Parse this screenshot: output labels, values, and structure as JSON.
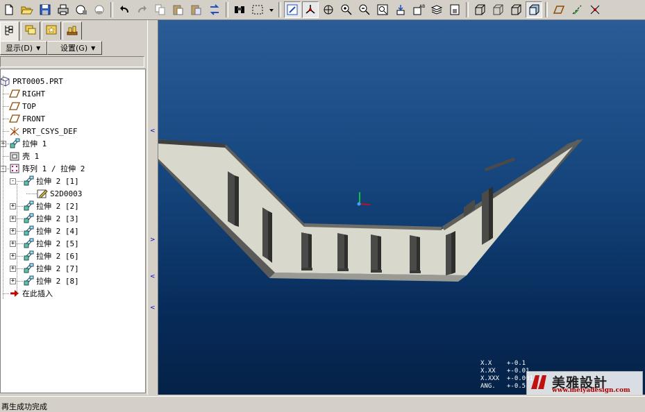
{
  "toolbar": {
    "icons": [
      "new-icon",
      "open-icon",
      "save-icon",
      "print-icon",
      "email-icon",
      "email-attach-icon",
      "undo-icon",
      "redo-icon",
      "copy-icon",
      "paste-icon",
      "paste-special-icon",
      "regenerate-icon",
      "find-icon",
      "select-box-icon",
      "dropdown-arrow-icon",
      "refit-icon",
      "spin-center-icon",
      "orient-icon",
      "zoom-in-icon",
      "zoom-out-icon",
      "zoom-fit-icon",
      "repaint-icon",
      "named-view-icon",
      "layers-icon",
      "view-manager-icon",
      "wireframe-icon",
      "hidden-line-icon",
      "no-hidden-icon",
      "shading-icon",
      "datum-plane-icon",
      "datum-axis-icon",
      "datum-point-icon"
    ]
  },
  "left_panel": {
    "tabs": [
      "model-tree-icon",
      "folder-browser-icon",
      "favorites-icon",
      "connections-icon"
    ],
    "show_menu": "显示(D)",
    "settings_menu": "设置(G)",
    "tree": [
      {
        "label": "PRT0005.PRT",
        "icon": "part-icon",
        "level": 0,
        "expander": ""
      },
      {
        "label": "RIGHT",
        "icon": "datum-plane-icon",
        "level": 1,
        "expander": ""
      },
      {
        "label": "TOP",
        "icon": "datum-plane-icon",
        "level": 1,
        "expander": ""
      },
      {
        "label": "FRONT",
        "icon": "datum-plane-icon",
        "level": 1,
        "expander": ""
      },
      {
        "label": "PRT_CSYS_DEF",
        "icon": "csys-icon",
        "level": 1,
        "expander": ""
      },
      {
        "label": "拉伸 1",
        "icon": "extrude-icon",
        "level": 1,
        "expander": "+"
      },
      {
        "label": "壳 1",
        "icon": "shell-icon",
        "level": 1,
        "expander": ""
      },
      {
        "label": "阵列 1 / 拉伸 2",
        "icon": "pattern-icon",
        "level": 1,
        "expander": "-"
      },
      {
        "label": "拉伸 2 [1]",
        "icon": "extrude-icon",
        "level": 2,
        "expander": "-"
      },
      {
        "label": "S2D0003",
        "icon": "sketch-icon",
        "level": 3,
        "expander": ""
      },
      {
        "label": "拉伸 2 [2]",
        "icon": "extrude-icon",
        "level": 2,
        "expander": "+"
      },
      {
        "label": "拉伸 2 [3]",
        "icon": "extrude-icon",
        "level": 2,
        "expander": "+"
      },
      {
        "label": "拉伸 2 [4]",
        "icon": "extrude-icon",
        "level": 2,
        "expander": "+"
      },
      {
        "label": "拉伸 2 [5]",
        "icon": "extrude-icon",
        "level": 2,
        "expander": "+"
      },
      {
        "label": "拉伸 2 [6]",
        "icon": "extrude-icon",
        "level": 2,
        "expander": "+"
      },
      {
        "label": "拉伸 2 [7]",
        "icon": "extrude-icon",
        "level": 2,
        "expander": "+"
      },
      {
        "label": "拉伸 2 [8]",
        "icon": "extrude-icon",
        "level": 2,
        "expander": "+"
      },
      {
        "label": "在此插入",
        "icon": "insert-here-icon",
        "level": 1,
        "expander": ""
      }
    ]
  },
  "graphics": {
    "background_top": "#2c5c97",
    "background_bottom": "#052247",
    "model_face_color": "#d8d8cc",
    "tolerance": [
      {
        "label": "X.X",
        "value": "+-0.1"
      },
      {
        "label": "X.XX",
        "value": "+-0.01"
      },
      {
        "label": "X.XXX",
        "value": "+-0.001"
      },
      {
        "label": "ANG.",
        "value": "+-0.5"
      }
    ],
    "watermark_title": "美雅設計",
    "watermark_url": "www.meiyadesign.com"
  },
  "status": {
    "message": "再生成功完成"
  }
}
